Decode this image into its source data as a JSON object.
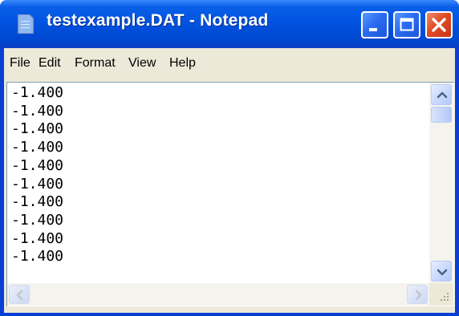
{
  "window": {
    "title": "testexample.DAT - Notepad"
  },
  "menu": {
    "items": [
      {
        "label": "File"
      },
      {
        "label": "Edit"
      },
      {
        "label": "Format"
      },
      {
        "label": "View"
      },
      {
        "label": "Help"
      }
    ]
  },
  "editor": {
    "text": "-1.400\n-1.400\n-1.400\n-1.400\n-1.400\n-1.400\n-1.400\n-1.400\n-1.400\n-1.400"
  },
  "icons": {
    "app": "notepad-icon",
    "minimize": "minimize-icon",
    "maximize": "maximize-icon",
    "close": "close-icon"
  },
  "colors": {
    "titlebar": "#0052df",
    "close_button": "#df4b22",
    "chrome": "#ece9d8"
  }
}
